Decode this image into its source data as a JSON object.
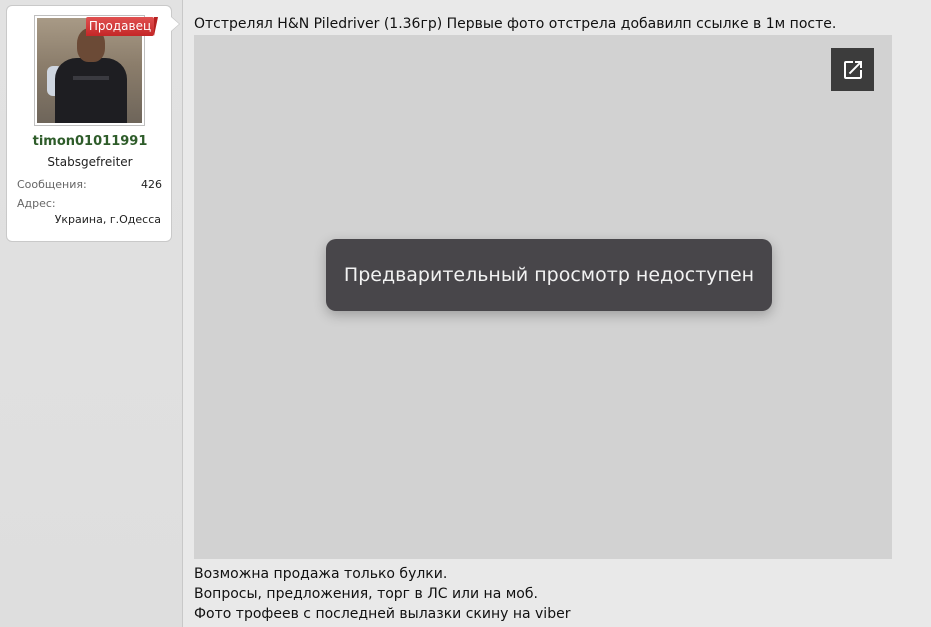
{
  "author": {
    "badge": "Продавец",
    "username": "timon01011991",
    "rank": "Stabsgefreiter",
    "stats": [
      {
        "label": "Сообщения:",
        "value": "426"
      },
      {
        "label": "Адрес:",
        "value": "Украина, г.Одесса"
      }
    ]
  },
  "post": {
    "intro": "Отстрелял H&N Piledriver (1.36гр) Первые фото отстрела добавилп ссылке в 1м посте.",
    "preview_message": "Предварительный просмотр недоступен",
    "open_icon": "open-in-new-icon",
    "signature": [
      "Возможна продажа только булки.",
      "Вопросы, предложения, торг в ЛС или на моб.",
      "Фото трофеев с последней вылазки скину на viber"
    ]
  },
  "colors": {
    "username": "#2e5c2a",
    "badge": "#c42727",
    "toast_bg": "#48464a",
    "preview_bg": "#d2d2d2"
  }
}
